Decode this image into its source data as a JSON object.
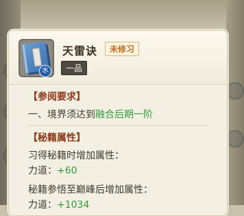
{
  "skill": {
    "name": "天雷诀",
    "status": "未修习",
    "grade": "一品",
    "element": "水"
  },
  "requirements": {
    "title": "【参阅要求】",
    "item_prefix": "一、境界须达到",
    "item_highlight": "融合后期一阶"
  },
  "attributes": {
    "title": "【秘籍属性】",
    "learn_title": "习得秘籍时增加属性：",
    "learn_stat": "力道：",
    "learn_value": "+60",
    "peak_title": "秘籍参悟至巅峰后增加属性：",
    "peak_stat": "力道：",
    "peak_value": "+1034"
  },
  "colors": {
    "section_title": "#8b3a1a",
    "highlight_green": "#2f9a3a",
    "status_orange": "#b8702c",
    "book_blue": "#3a6fae"
  }
}
